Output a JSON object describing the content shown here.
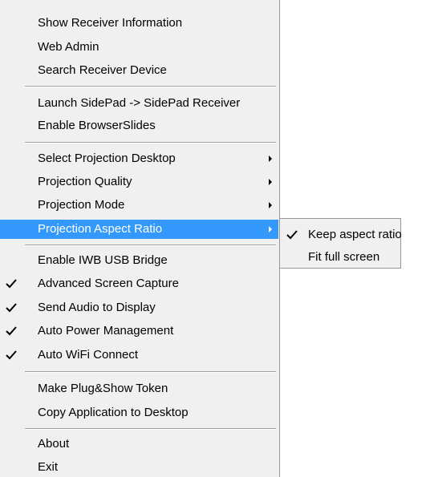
{
  "main_menu": {
    "group1": [
      "Show Receiver Information",
      "Web Admin",
      "Search Receiver Device"
    ],
    "group2": [
      "Launch SidePad -> SidePad Receiver",
      "Enable BrowserSlides"
    ],
    "group3": [
      "Select Projection Desktop",
      "Projection Quality",
      "Projection Mode",
      "Projection Aspect Ratio"
    ],
    "group4": [
      "Enable IWB USB Bridge",
      "Advanced Screen Capture",
      "Send Audio to Display",
      "Auto Power Management",
      "Auto WiFi Connect"
    ],
    "group5": [
      "Make Plug&Show Token",
      "Copy Application to Desktop"
    ],
    "group6": [
      "About",
      "Exit"
    ]
  },
  "sub_menu": {
    "items": [
      "Keep aspect ratio",
      "Fit full screen"
    ]
  },
  "colors": {
    "highlight": "#3399ff",
    "menu_bg": "#f0f0f0"
  }
}
